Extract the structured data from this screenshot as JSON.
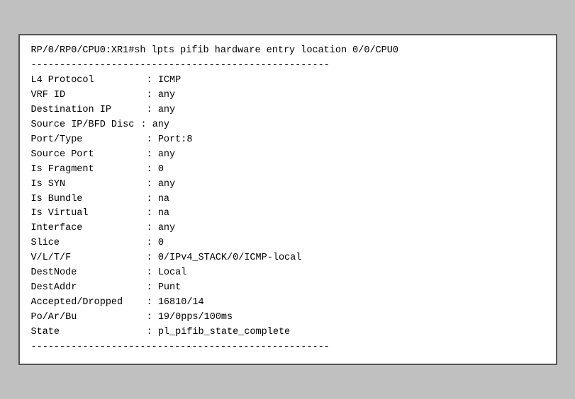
{
  "terminal": {
    "command_line": "RP/0/RP0/CPU0:XR1#sh lpts pifib hardware entry location 0/0/CPU0",
    "divider": "----------------------------------------------------",
    "entries": [
      {
        "key": "L4 Protocol",
        "sep": " : ",
        "value": "ICMP"
      },
      {
        "key": "VRF ID",
        "sep": " : ",
        "value": "any"
      },
      {
        "key": "Destination IP",
        "sep": " : ",
        "value": "any"
      },
      {
        "key": "Source IP/BFD Disc",
        "sep": ": ",
        "value": "any"
      },
      {
        "key": "Port/Type",
        "sep": " : ",
        "value": "Port:8"
      },
      {
        "key": "Source Port",
        "sep": " : ",
        "value": "any"
      },
      {
        "key": "Is Fragment",
        "sep": " : ",
        "value": "0"
      },
      {
        "key": "Is SYN",
        "sep": " : ",
        "value": "any"
      },
      {
        "key": "Is Bundle",
        "sep": " : ",
        "value": "na"
      },
      {
        "key": "Is Virtual",
        "sep": " : ",
        "value": "na"
      },
      {
        "key": "Interface",
        "sep": " : ",
        "value": "any"
      },
      {
        "key": "Slice",
        "sep": " : ",
        "value": "0"
      },
      {
        "key": "V/L/T/F",
        "sep": " : ",
        "value": "0/IPv4_STACK/0/ICMP-local"
      },
      {
        "key": "DestNode",
        "sep": " : ",
        "value": "Local"
      },
      {
        "key": "DestAddr",
        "sep": " : ",
        "value": "Punt"
      },
      {
        "key": "Accepted/Dropped",
        "sep": " : ",
        "value": "16810/14"
      },
      {
        "key": "Po/Ar/Bu",
        "sep": " : ",
        "value": "19/0pps/100ms"
      },
      {
        "key": "State",
        "sep": " : ",
        "value": "pl_pifib_state_complete"
      }
    ]
  }
}
